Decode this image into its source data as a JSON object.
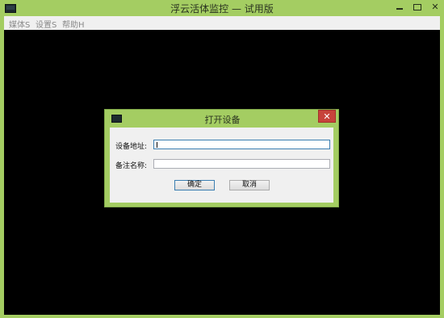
{
  "window": {
    "title": "浮云活体监控 — 试用版",
    "controls": {
      "minimize": "",
      "maximize": "",
      "close": "✕"
    }
  },
  "menu": [
    {
      "label": "媒体S"
    },
    {
      "label": "设置S"
    },
    {
      "label": "帮助H"
    }
  ],
  "dialog": {
    "title": "打开设备",
    "close_label": "✕",
    "fields": {
      "address": {
        "label": "设备地址:",
        "value": ""
      },
      "note": {
        "label": "备注名称:",
        "value": ""
      }
    },
    "buttons": {
      "ok": "确定",
      "cancel": "取消"
    }
  }
}
